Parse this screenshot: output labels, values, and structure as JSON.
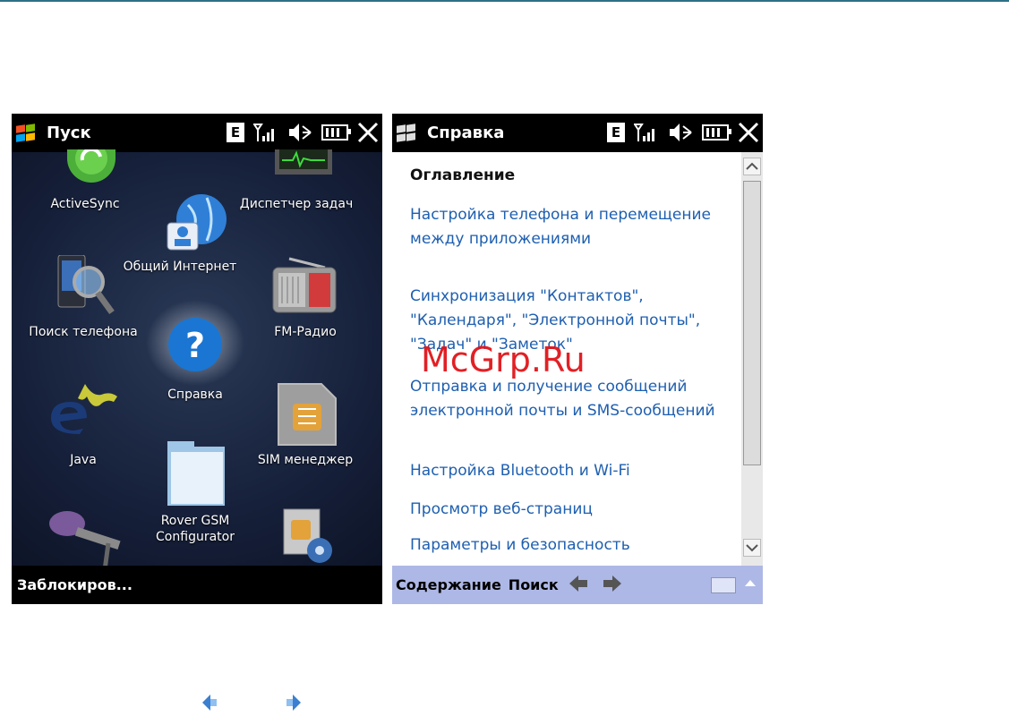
{
  "colors": {
    "accent_line": "#2f6f86",
    "link": "#1e5fb0",
    "help_bar": "#aeb8e6",
    "watermark": "#e0151a"
  },
  "left_screen": {
    "status_title": "Пуск",
    "status_icons": [
      "edge-icon",
      "signal-icon",
      "speaker-mute-icon",
      "battery-icon",
      "close-icon"
    ],
    "edge_label": "E",
    "apps": [
      {
        "label": "ActiveSync",
        "icon": "activesync-icon"
      },
      {
        "label": "Диспетчер задач",
        "icon": "task-manager-icon"
      },
      {
        "label": "Общий Интернет",
        "icon": "internet-sharing-icon"
      },
      {
        "label": "Поиск телефона",
        "icon": "phone-search-icon"
      },
      {
        "label": "FM-Радио",
        "icon": "radio-icon"
      },
      {
        "label": "Справка",
        "icon": "help-icon"
      },
      {
        "label": "Java",
        "icon": "java-icon"
      },
      {
        "label": "SIM менеджер",
        "icon": "sim-card-icon"
      },
      {
        "label": "Rover GSM Configurator",
        "icon": "folder-icon"
      },
      {
        "label": "",
        "icon": "microphone-icon"
      },
      {
        "label": "",
        "icon": "sim-settings-icon"
      }
    ],
    "bottom_label": "Заблокиров..."
  },
  "right_screen": {
    "status_title": "Справка",
    "edge_label": "E",
    "toc_title": "Оглавление",
    "links": [
      "Настройка телефона и перемещение между приложениями",
      "Синхронизация \"Контактов\", \"Календаря\", \"Электронной почты\", \"Задач\" и \"Заметок\"",
      "Отправка и получение сообщений электронной почты и SMS-сообщений",
      "Настройка Bluetooth и Wi-Fi",
      "Просмотр веб-страниц",
      "Параметры и безопасность"
    ],
    "bottom_bar": {
      "contents": "Содержание",
      "search": "Поиск"
    }
  },
  "watermark": "McGrp.Ru"
}
